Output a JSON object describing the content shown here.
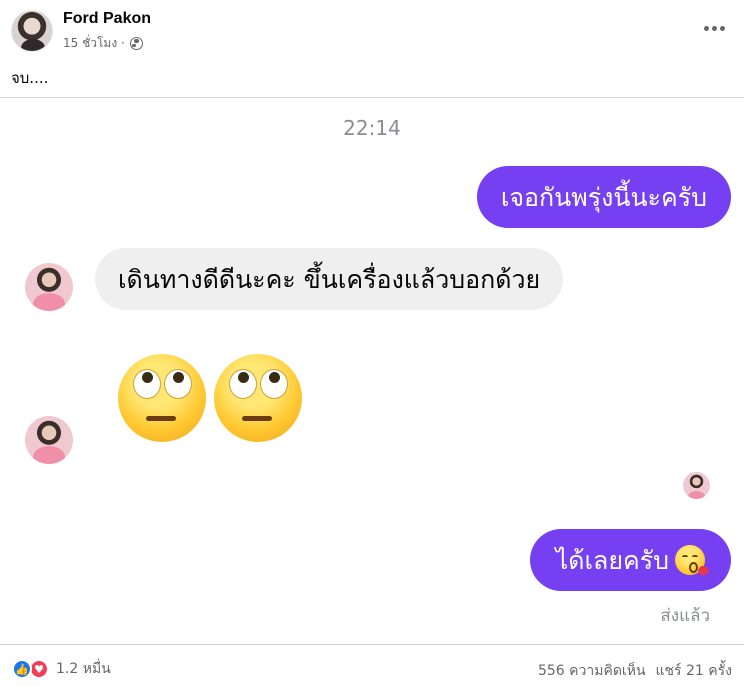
{
  "post": {
    "author": "Ford Pakon",
    "time": "15 ชั่วโมง ·",
    "text": "จบ...."
  },
  "chat": {
    "timestamp": "22:14",
    "messages": [
      {
        "side": "outgoing",
        "text": "เจอกันพรุ่งนี้นะครับ"
      },
      {
        "side": "incoming",
        "text": "เดินทางดีดีนะคะ ขึ้นเครื่องแล้วบอกด้วย"
      },
      {
        "side": "incoming",
        "emoji": [
          "eye-roll-face",
          "eye-roll-face"
        ]
      },
      {
        "side": "outgoing",
        "text": "ได้เลยครับ",
        "emoji": "kissing-face"
      }
    ],
    "sent_status": "ส่งแล้ว",
    "colors": {
      "outgoing_bubble": "#7640f2",
      "incoming_bubble": "#efefef"
    }
  },
  "footer": {
    "reaction_count": "1.2 หมื่น",
    "comments": "556 ความคิดเห็น",
    "shares": "แชร์ 21 ครั้ง",
    "reactions": [
      "like-icon",
      "love-icon"
    ]
  }
}
